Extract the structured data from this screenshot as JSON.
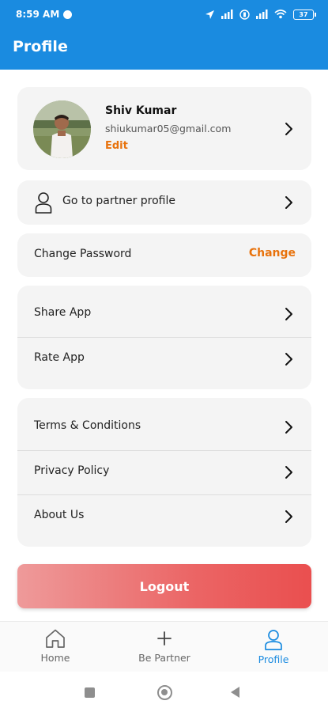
{
  "status_bar": {
    "time": "8:59 AM",
    "battery": "37"
  },
  "header": {
    "title": "Profile"
  },
  "profile": {
    "name": "Shiv Kumar",
    "email": "shiukumar05@gmail.com",
    "edit_label": "Edit"
  },
  "partner": {
    "label": "Go to partner profile"
  },
  "password": {
    "label": "Change Password",
    "action": "Change"
  },
  "app_group": {
    "items": [
      {
        "label": "Share App"
      },
      {
        "label": "Rate App"
      }
    ]
  },
  "info_group": {
    "items": [
      {
        "label": "Terms & Conditions"
      },
      {
        "label": "Privacy Policy"
      },
      {
        "label": "About Us"
      }
    ]
  },
  "logout": {
    "label": "Logout"
  },
  "bottom_nav": {
    "items": [
      {
        "label": "Home",
        "icon": "home-icon",
        "active": false
      },
      {
        "label": "Be Partner",
        "icon": "plus-icon",
        "active": false
      },
      {
        "label": "Profile",
        "icon": "user-icon",
        "active": true
      }
    ]
  },
  "colors": {
    "primary": "#1a8be0",
    "accent": "#e8720c",
    "logout_gradient_start": "#ee9a9a",
    "logout_gradient_end": "#ea4f4f",
    "card_bg": "#f4f4f4"
  }
}
